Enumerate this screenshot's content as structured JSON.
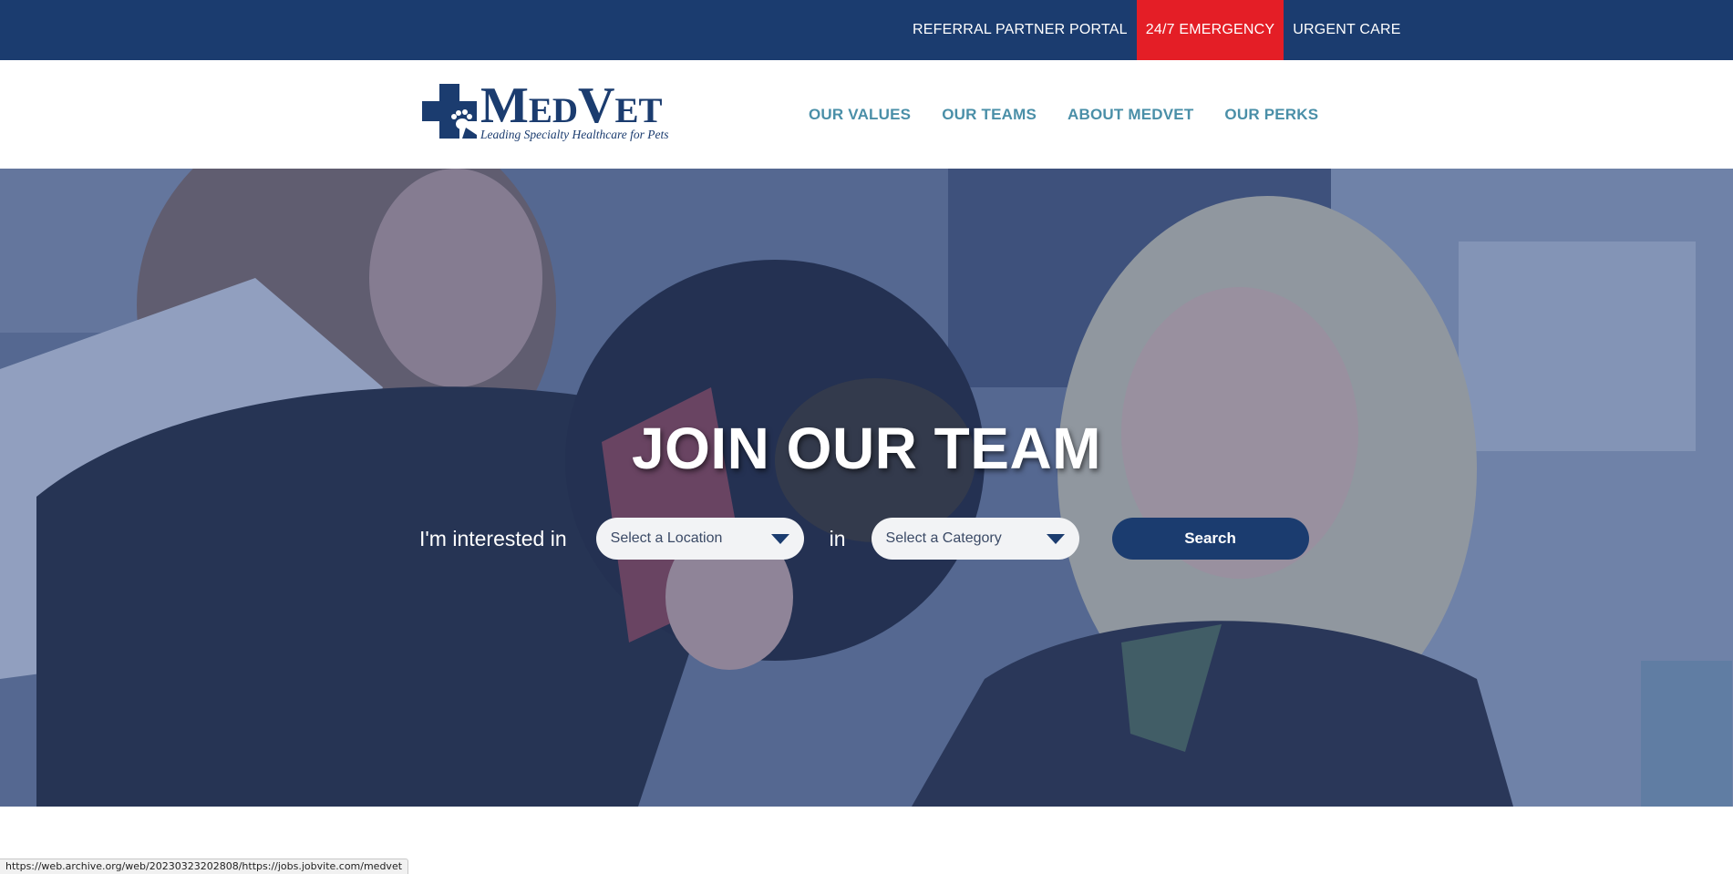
{
  "topbar": {
    "links": [
      {
        "label": "REFERRAL PARTNER PORTAL"
      },
      {
        "label": "24/7 EMERGENCY"
      },
      {
        "label": "URGENT CARE"
      }
    ],
    "emergency_color": "#e41e26",
    "background_color": "#1b3c6f"
  },
  "header": {
    "logo": {
      "brand": "MedVet",
      "tagline": "Leading Specialty Healthcare for Pets",
      "icon": "medvet-paw-cross-logo"
    },
    "nav": [
      {
        "label": "OUR VALUES"
      },
      {
        "label": "OUR TEAMS"
      },
      {
        "label": "ABOUT MEDVET"
      },
      {
        "label": "OUR PERKS"
      }
    ],
    "nav_color": "#4a8fa8"
  },
  "hero": {
    "title": "JOIN OUR TEAM",
    "interest_label": "I'm interested in",
    "location_select": {
      "value": "Select a Location",
      "icon": "caret-down-icon"
    },
    "in_label": "in",
    "category_select": {
      "value": "Select a Category",
      "icon": "caret-down-icon"
    },
    "search_button": "Search",
    "image": "veterinarians-with-black-dog-photo"
  },
  "statusbar": {
    "url": "https://web.archive.org/web/20230323202808/https://jobs.jobvite.com/medvet"
  }
}
